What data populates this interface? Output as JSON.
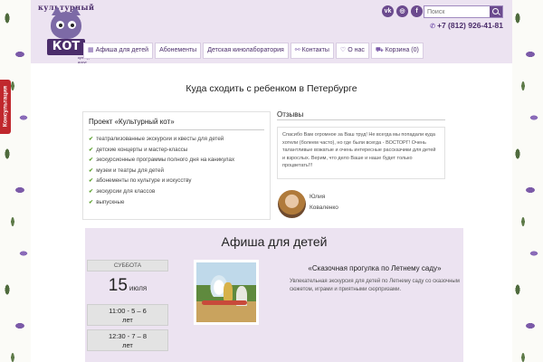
{
  "logo": {
    "arc_text": "культурный",
    "name": "КОТ",
    "sub": "культурный досуг"
  },
  "socials": [
    {
      "icon": "vk-icon",
      "glyph": "vk"
    },
    {
      "icon": "instagram-icon",
      "glyph": "◎"
    },
    {
      "icon": "facebook-icon",
      "glyph": "f"
    }
  ],
  "search": {
    "placeholder": "Поиск"
  },
  "phone": "+7 (812) 926-41-81",
  "nav": [
    {
      "label": "Афиша для детей",
      "icon": "calendar-icon",
      "glyph": "▦"
    },
    {
      "label": "Абонементы",
      "icon": "",
      "glyph": ""
    },
    {
      "label": "Детская кинолаборатория",
      "icon": "",
      "glyph": ""
    },
    {
      "label": "Контакты",
      "icon": "link-icon",
      "glyph": "⚯"
    },
    {
      "label": "О нас",
      "icon": "heart-icon",
      "glyph": "♡"
    },
    {
      "label": "Корзина (0)",
      "icon": "cart-icon",
      "glyph": "⛟"
    }
  ],
  "consult": "Консультация",
  "main": {
    "title": "Куда сходить с ребенком в Петербурге"
  },
  "project": {
    "title": "Проект «Культурный кот»",
    "items": [
      "театрализованные экскурсии и квесты для детей",
      "детские концерты и мастер-классы",
      "экскурсионные программы полного дня на каникулах",
      "музеи и театры для детей",
      "абонементы по культуре и искусству",
      "экскурсии для классов",
      "выпускные"
    ]
  },
  "reviews": {
    "label": "Отзывы",
    "text": "Спасибо Вам огромное за Ваш труд! Не всегда мы попадали куда хотели (болеем часто), но где были всегда - ВОСТОРГ! Очень талантливые вожатые и очень интересные рассказчики для детей и взрослых. Верим, что дело Ваше и наше будет только процветать!!!",
    "first_name": "Юлия",
    "last_name": "Коваленко"
  },
  "afisha": {
    "title": "Афиша для детей",
    "day": "СУББОТА",
    "date_num": "15",
    "date_month": "июля",
    "slots": [
      {
        "time": "11:00 - 5 – 6",
        "age": "лет"
      },
      {
        "time": "12:30 - 7 – 8",
        "age": "лет"
      }
    ],
    "event_title": "«Сказочная прогулка по Летнему саду»",
    "event_desc": "Увлекательная экскурсия для детей по Летнему саду со сказочным сюжетом, играми и приятными сюрпризами."
  }
}
